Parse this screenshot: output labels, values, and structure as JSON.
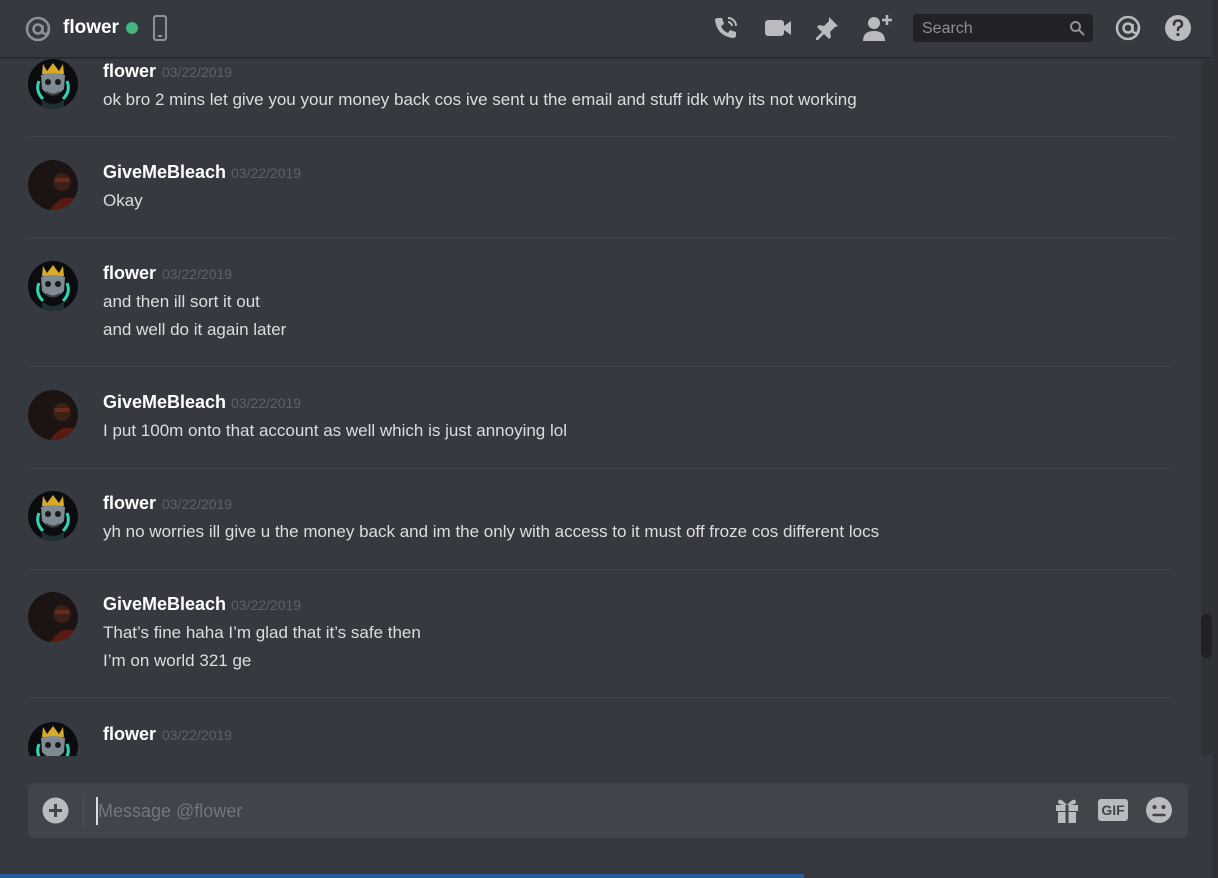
{
  "header": {
    "channel_name": "flower",
    "search_placeholder": "Search"
  },
  "messages": [
    {
      "author": "flower",
      "timestamp": "03/22/2019",
      "lines": [
        "ok bro 2 mins let give you your money back cos ive sent u the email and stuff idk why its not working"
      ]
    },
    {
      "author": "GiveMeBleach",
      "timestamp": "03/22/2019",
      "lines": [
        "Okay"
      ]
    },
    {
      "author": "flower",
      "timestamp": "03/22/2019",
      "lines": [
        "and then ill sort it out",
        "and well do it again later"
      ]
    },
    {
      "author": "GiveMeBleach",
      "timestamp": "03/22/2019",
      "lines": [
        "I put 100m onto that account as well which is just annoying lol"
      ]
    },
    {
      "author": "flower",
      "timestamp": "03/22/2019",
      "lines": [
        "yh no worries ill give u the money back and im the only with access to it must off froze cos different locs"
      ]
    },
    {
      "author": "GiveMeBleach",
      "timestamp": "03/22/2019",
      "lines": [
        "That’s fine haha I’m glad that it’s safe then",
        "I’m on world 321 ge"
      ]
    },
    {
      "author": "flower",
      "timestamp": "03/22/2019",
      "lines": []
    }
  ],
  "composer": {
    "placeholder": "Message @flower",
    "gif_label": "GIF"
  },
  "colors": {
    "background": "#36393f",
    "online_status": "#43b581",
    "composer_bg": "#40444b"
  }
}
